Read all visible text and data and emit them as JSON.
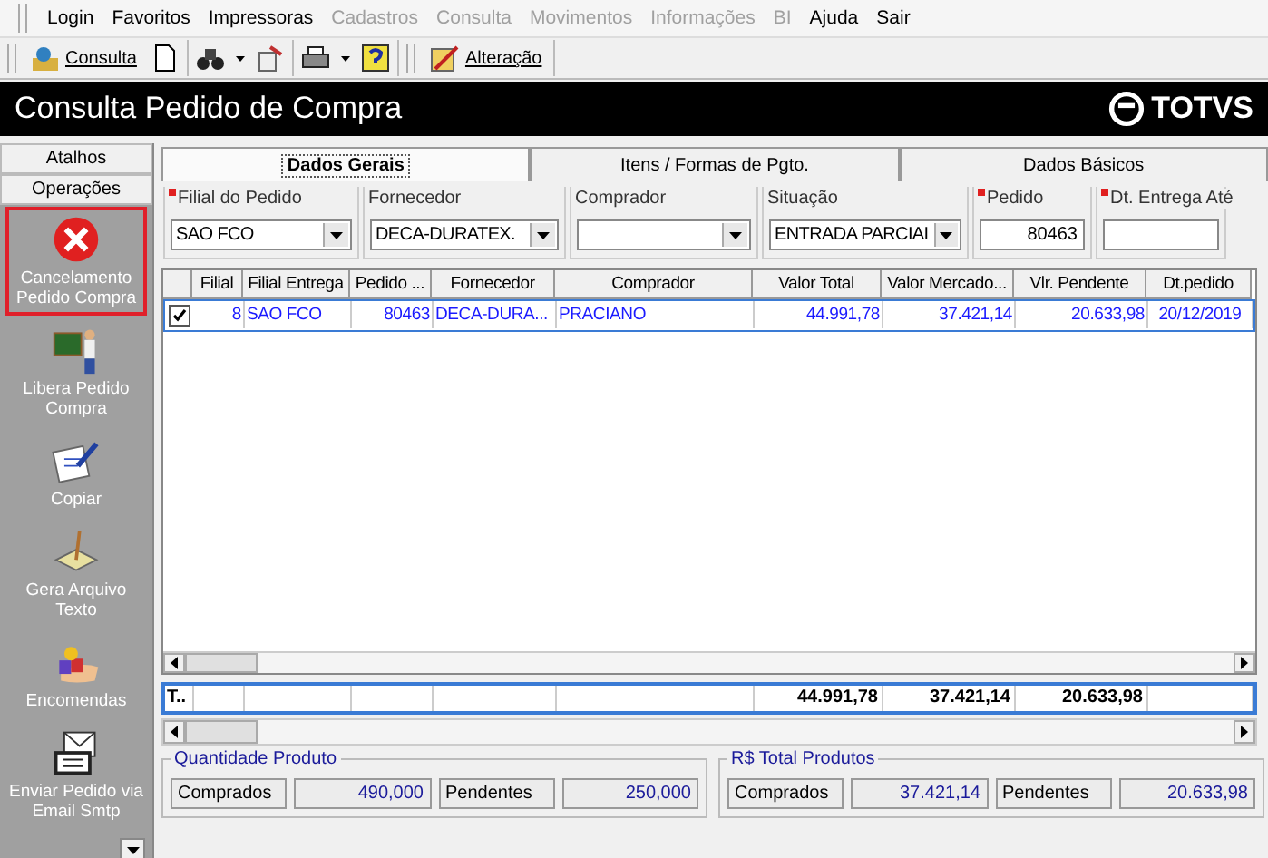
{
  "menu": [
    {
      "label": "Login",
      "disabled": false
    },
    {
      "label": "Favoritos",
      "disabled": false
    },
    {
      "label": "Impressoras",
      "disabled": false
    },
    {
      "label": "Cadastros",
      "disabled": true
    },
    {
      "label": "Consulta",
      "disabled": true
    },
    {
      "label": "Movimentos",
      "disabled": true
    },
    {
      "label": "Informações",
      "disabled": true
    },
    {
      "label": "BI",
      "disabled": true
    },
    {
      "label": "Ajuda",
      "disabled": false
    },
    {
      "label": "Sair",
      "disabled": false
    }
  ],
  "toolbar": {
    "consult_label": "Consulta",
    "edit_label": "Alteração"
  },
  "window": {
    "title": "Consulta Pedido de Compra",
    "logo": "TOTVS"
  },
  "sidebar": {
    "headers": [
      "Atalhos",
      "Operações"
    ],
    "items": [
      {
        "kind": "cancel",
        "label": "Cancelamento Pedido Compra",
        "selected": true
      },
      {
        "kind": "teacher",
        "label": "Libera Pedido Compra",
        "selected": false
      },
      {
        "kind": "copy",
        "label": "Copiar",
        "selected": false
      },
      {
        "kind": "text",
        "label": "Gera Arquivo Texto",
        "selected": false
      },
      {
        "kind": "orders",
        "label": "Encomendas",
        "selected": false
      },
      {
        "kind": "mail",
        "label": "Enviar Pedido via Email Smtp",
        "selected": false
      }
    ]
  },
  "tabs": [
    {
      "label": "Dados Gerais",
      "selected": true
    },
    {
      "label": "Itens / Formas de Pgto.",
      "selected": false
    },
    {
      "label": "Dados Básicos",
      "selected": false
    }
  ],
  "filters": [
    {
      "kind": "combo",
      "label": "Filial do Pedido",
      "value": "SAO FCO",
      "required": true
    },
    {
      "kind": "combo",
      "label": "Fornecedor",
      "value": "DECA-DURATEX.",
      "required": false
    },
    {
      "kind": "combo",
      "label": "Comprador",
      "required": false
    },
    {
      "kind": "combo",
      "label": "Situação",
      "value": "ENTRADA PARCIAI",
      "required": false
    },
    {
      "kind": "text",
      "label": "Pedido",
      "value": "80463",
      "required": true
    },
    {
      "kind": "text",
      "label": "Dt. Entrega Até",
      "required": true
    }
  ],
  "grid": {
    "columns": [
      "Filial",
      "Filial Entrega",
      "Pedido ...",
      "Fornecedor",
      "Comprador",
      "Valor Total",
      "Valor Mercado...",
      "Vlr. Pendente",
      "Dt.pedido"
    ],
    "rows": [
      {
        "checked": true,
        "selected": true,
        "cells": [
          "8",
          "SAO FCO",
          "80463",
          "DECA-DURA...",
          "PRACIANO",
          "44.991,78",
          "37.421,14",
          "20.633,98",
          "20/12/2019"
        ]
      }
    ],
    "totals": {
      "label": "T..",
      "valor_total": "44.991,78",
      "valor_mercado": "37.421,14",
      "vlr_pendente": "20.633,98"
    }
  },
  "summary": [
    {
      "title": "Quantidade Produto",
      "fields": [
        {
          "label": "Comprados",
          "value": "490,000"
        },
        {
          "label": "Pendentes",
          "value": "250,000"
        }
      ]
    },
    {
      "title": "R$ Total Produtos",
      "fields": [
        {
          "label": "Comprados",
          "value": "37.421,14"
        },
        {
          "label": "Pendentes",
          "value": "20.633,98"
        }
      ]
    }
  ]
}
